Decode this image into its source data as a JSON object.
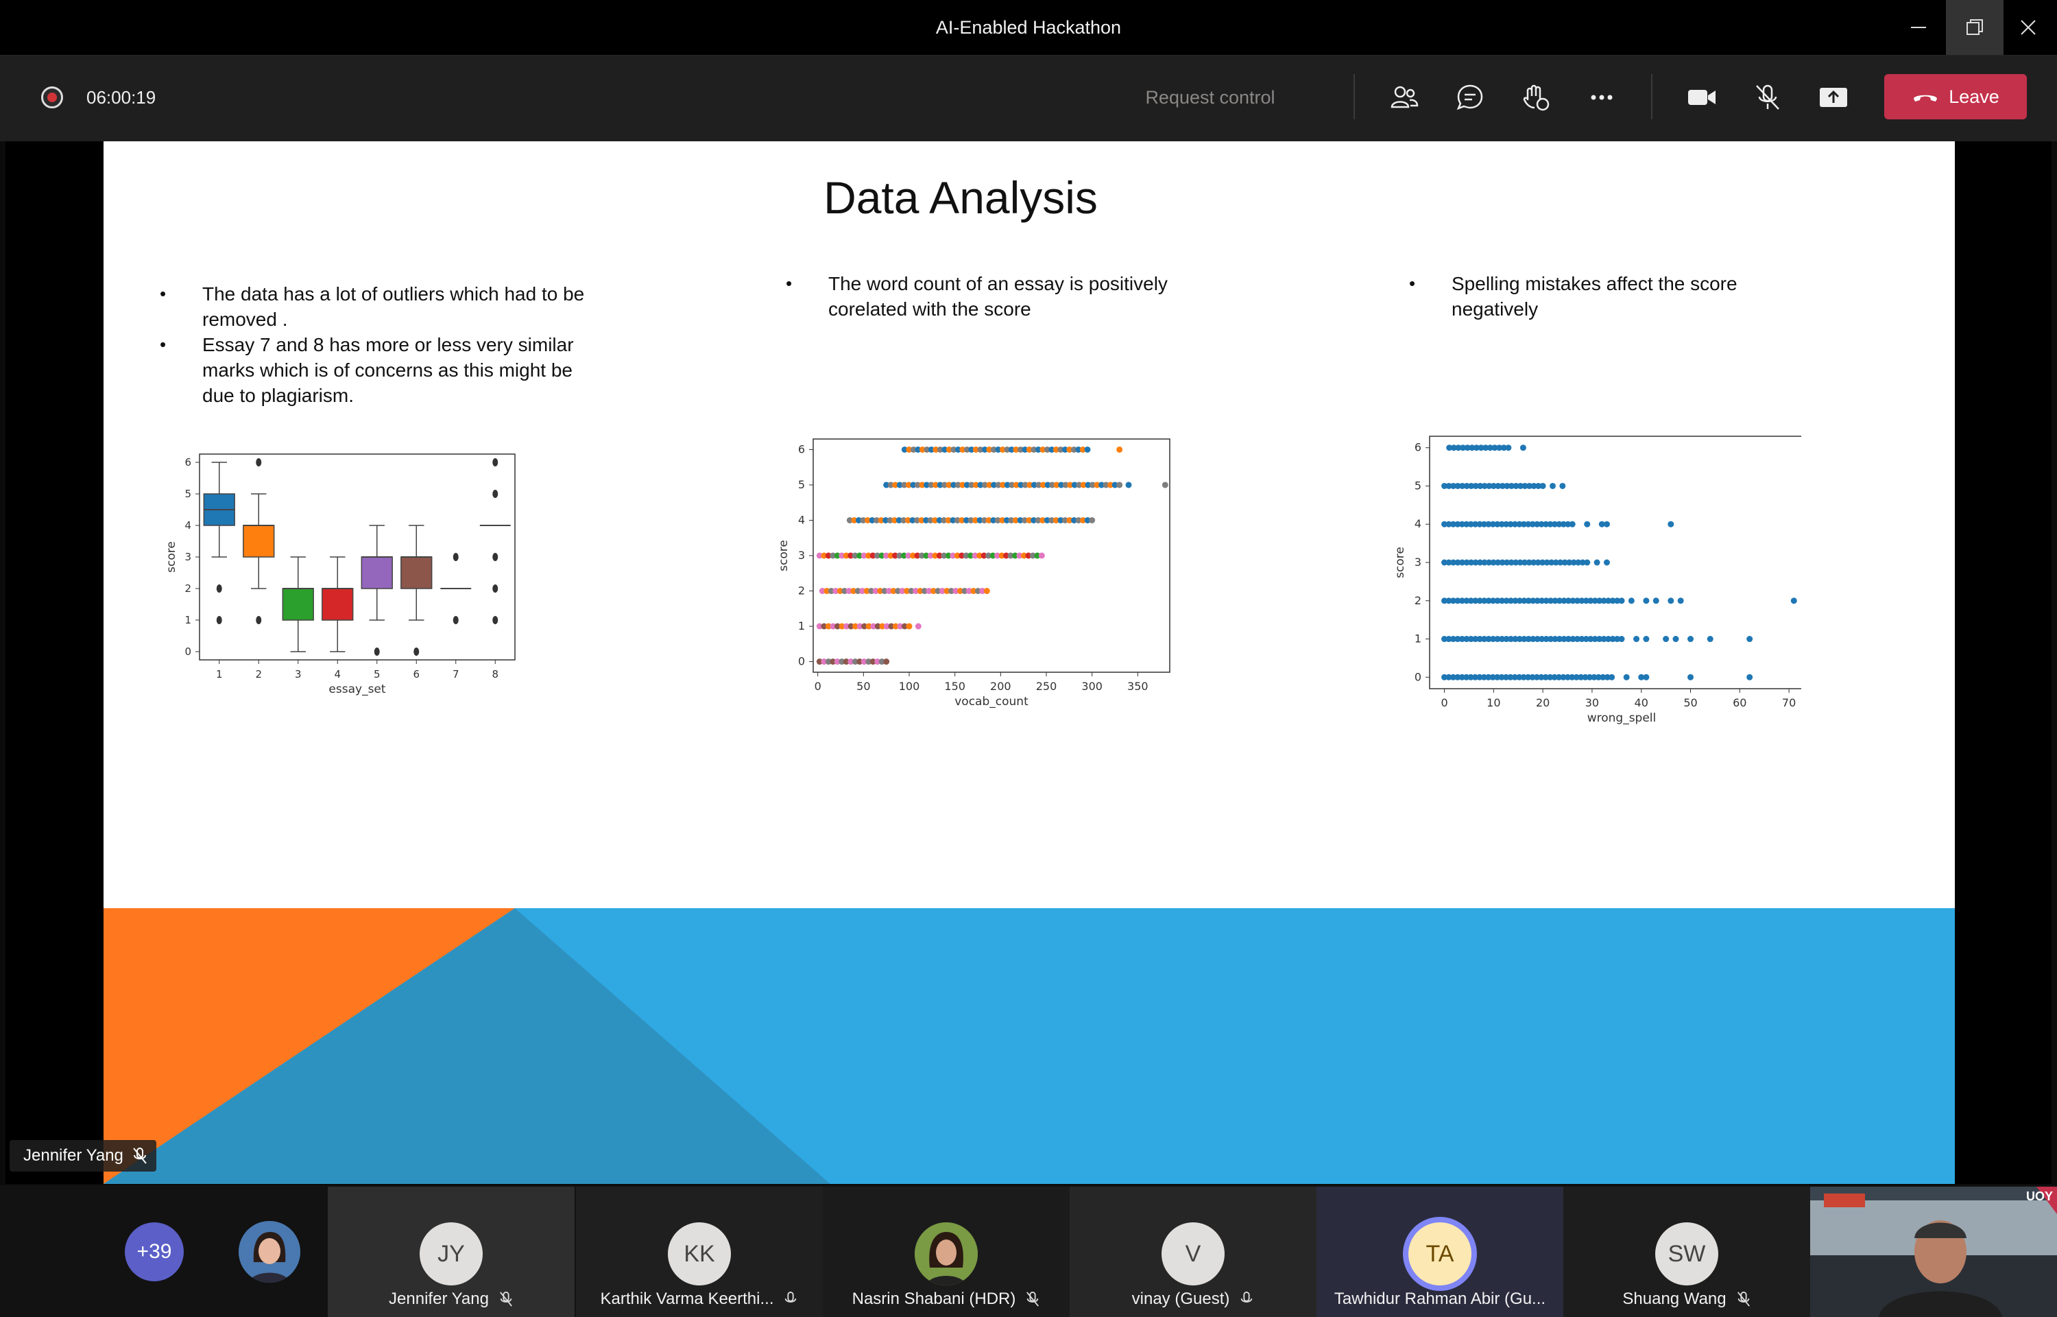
{
  "window": {
    "title": "AI-Enabled Hackathon"
  },
  "toolbar": {
    "timer": "06:00:19",
    "request_control": "Request control",
    "leave_label": "Leave"
  },
  "slide": {
    "title": "Data Analysis",
    "column1_bullets": [
      "The data has a lot of outliers which had to be removed .",
      "Essay 7 and 8 has more or less very similar marks which is of concerns as this might be due to plagiarism."
    ],
    "column2_bullets": [
      "The word count of an essay is positively corelated with the score"
    ],
    "column3_bullets": [
      "Spelling mistakes affect the score negatively"
    ]
  },
  "colors": {
    "box_blue": "#1f77b4",
    "box_orange": "#ff7f0e",
    "box_green": "#2ca02c",
    "box_red": "#d62728",
    "box_purple": "#9467bd",
    "box_brown": "#8c564b",
    "slide_blue": "#30a9e3",
    "slide_orange": "#ff781f",
    "leave": "#c4314b"
  },
  "chart_data": [
    {
      "type": "box",
      "xlabel": "essay_set",
      "ylabel": "score",
      "categories": [
        "1",
        "2",
        "3",
        "4",
        "5",
        "6",
        "7",
        "8"
      ],
      "ylim": [
        0,
        6
      ],
      "yticks": [
        "0",
        "1",
        "2",
        "3",
        "4",
        "5",
        "6"
      ],
      "boxes": [
        {
          "q1": 4,
          "median": 4.5,
          "q3": 5,
          "whisker_low": 3,
          "whisker_high": 6,
          "outliers": [
            2,
            1
          ],
          "color": "#1f77b4"
        },
        {
          "q1": 3,
          "median": 4,
          "q3": 4,
          "whisker_low": 2,
          "whisker_high": 5,
          "outliers": [
            6,
            1
          ],
          "color": "#ff7f0e"
        },
        {
          "q1": 1,
          "median": 2,
          "q3": 2,
          "whisker_low": 0,
          "whisker_high": 3,
          "outliers": [],
          "color": "#2ca02c"
        },
        {
          "q1": 1,
          "median": 2,
          "q3": 2,
          "whisker_low": 0,
          "whisker_high": 3,
          "outliers": [],
          "color": "#d62728"
        },
        {
          "q1": 2,
          "median": 3,
          "q3": 3,
          "whisker_low": 1,
          "whisker_high": 4,
          "outliers": [
            0
          ],
          "color": "#9467bd"
        },
        {
          "q1": 2,
          "median": 3,
          "q3": 3,
          "whisker_low": 1,
          "whisker_high": 4,
          "outliers": [
            0
          ],
          "color": "#8c564b"
        },
        {
          "q1": 2,
          "median": 2,
          "q3": 2,
          "whisker_low": 2,
          "whisker_high": 2,
          "outliers": [
            3,
            1
          ],
          "color": "#444444"
        },
        {
          "q1": 4,
          "median": 4,
          "q3": 4,
          "whisker_low": 4,
          "whisker_high": 4,
          "outliers": [
            6,
            5,
            3,
            2,
            1
          ],
          "color": "#444444"
        }
      ]
    },
    {
      "type": "scatter",
      "xlabel": "vocab_count",
      "ylabel": "score",
      "xlim": [
        -5,
        385
      ],
      "ylim": [
        -0.3,
        6.3
      ],
      "xticks": [
        "0",
        "50",
        "100",
        "150",
        "200",
        "250",
        "300",
        "350"
      ],
      "yticks": [
        "0",
        "1",
        "2",
        "3",
        "4",
        "5",
        "6"
      ],
      "bands": [
        {
          "y": 6,
          "x_min": 95,
          "x_max": 290,
          "outliers": [
            295,
            330
          ],
          "colors": [
            "#1f77b4",
            "#ff7f0e",
            "#7f7f7f"
          ]
        },
        {
          "y": 5,
          "x_min": 75,
          "x_max": 330,
          "outliers": [
            340,
            380
          ],
          "colors": [
            "#1f77b4",
            "#7f7f7f",
            "#ff7f0e"
          ]
        },
        {
          "y": 4,
          "x_min": 35,
          "x_max": 300,
          "outliers": [],
          "colors": [
            "#7f7f7f",
            "#ff7f0e",
            "#1f77b4"
          ]
        },
        {
          "y": 3,
          "x_min": 2,
          "x_max": 245,
          "outliers": [],
          "colors": [
            "#7f7f7f",
            "#ff7f0e",
            "#2ca02c",
            "#d62728",
            "#e377c2"
          ]
        },
        {
          "y": 2,
          "x_min": 5,
          "x_max": 185,
          "outliers": [],
          "colors": [
            "#e377c2",
            "#ff7f0e",
            "#7f7f7f"
          ]
        },
        {
          "y": 1,
          "x_min": 2,
          "x_max": 100,
          "outliers": [
            110
          ],
          "colors": [
            "#e377c2",
            "#8c564b",
            "#ff7f0e"
          ]
        },
        {
          "y": 0,
          "x_min": 2,
          "x_max": 75,
          "outliers": [],
          "colors": [
            "#8c564b",
            "#e377c2",
            "#7f7f7f"
          ]
        }
      ]
    },
    {
      "type": "scatter",
      "xlabel": "wrong_spell",
      "ylabel": "score",
      "xlim": [
        -3,
        75
      ],
      "ylim": [
        -0.3,
        6.3
      ],
      "xticks": [
        "0",
        "10",
        "20",
        "30",
        "40",
        "50",
        "60",
        "70"
      ],
      "yticks": [
        "0",
        "1",
        "2",
        "3",
        "4",
        "5",
        "6"
      ],
      "bands": [
        {
          "y": 6,
          "x_min": 1,
          "x_max": 13,
          "outliers": [
            16
          ],
          "colors": [
            "#1f77b4"
          ]
        },
        {
          "y": 5,
          "x_min": 0,
          "x_max": 20,
          "outliers": [
            22,
            24
          ],
          "colors": [
            "#1f77b4"
          ]
        },
        {
          "y": 4,
          "x_min": 0,
          "x_max": 26,
          "outliers": [
            29,
            32,
            33,
            46
          ],
          "colors": [
            "#1f77b4"
          ]
        },
        {
          "y": 3,
          "x_min": 0,
          "x_max": 29,
          "outliers": [
            31,
            33
          ],
          "colors": [
            "#1f77b4"
          ]
        },
        {
          "y": 2,
          "x_min": 0,
          "x_max": 36,
          "outliers": [
            38,
            41,
            43,
            46,
            48,
            71
          ],
          "colors": [
            "#1f77b4"
          ]
        },
        {
          "y": 1,
          "x_min": 0,
          "x_max": 36,
          "outliers": [
            39,
            41,
            45,
            47,
            50,
            54,
            62
          ],
          "colors": [
            "#1f77b4"
          ]
        },
        {
          "y": 0,
          "x_min": 0,
          "x_max": 34,
          "outliers": [
            37,
            40,
            41,
            50,
            62
          ],
          "colors": [
            "#1f77b4"
          ]
        }
      ]
    }
  ],
  "presenter": {
    "name": "Jennifer Yang"
  },
  "participants": {
    "overflow_count": "+39",
    "tiles": [
      {
        "name": "Jennifer Yang",
        "initials": "JY"
      },
      {
        "name": "Karthik Varma Keerthi...",
        "initials": "KK"
      },
      {
        "name": "Nasrin Shabani (HDR)",
        "initials": ""
      },
      {
        "name": "vinay (Guest)",
        "initials": "V"
      },
      {
        "name": "Tawhidur Rahman Abir (Gu...",
        "initials": "TA"
      },
      {
        "name": "Shuang Wang",
        "initials": "SW"
      }
    ],
    "video_badge": "UOY"
  }
}
